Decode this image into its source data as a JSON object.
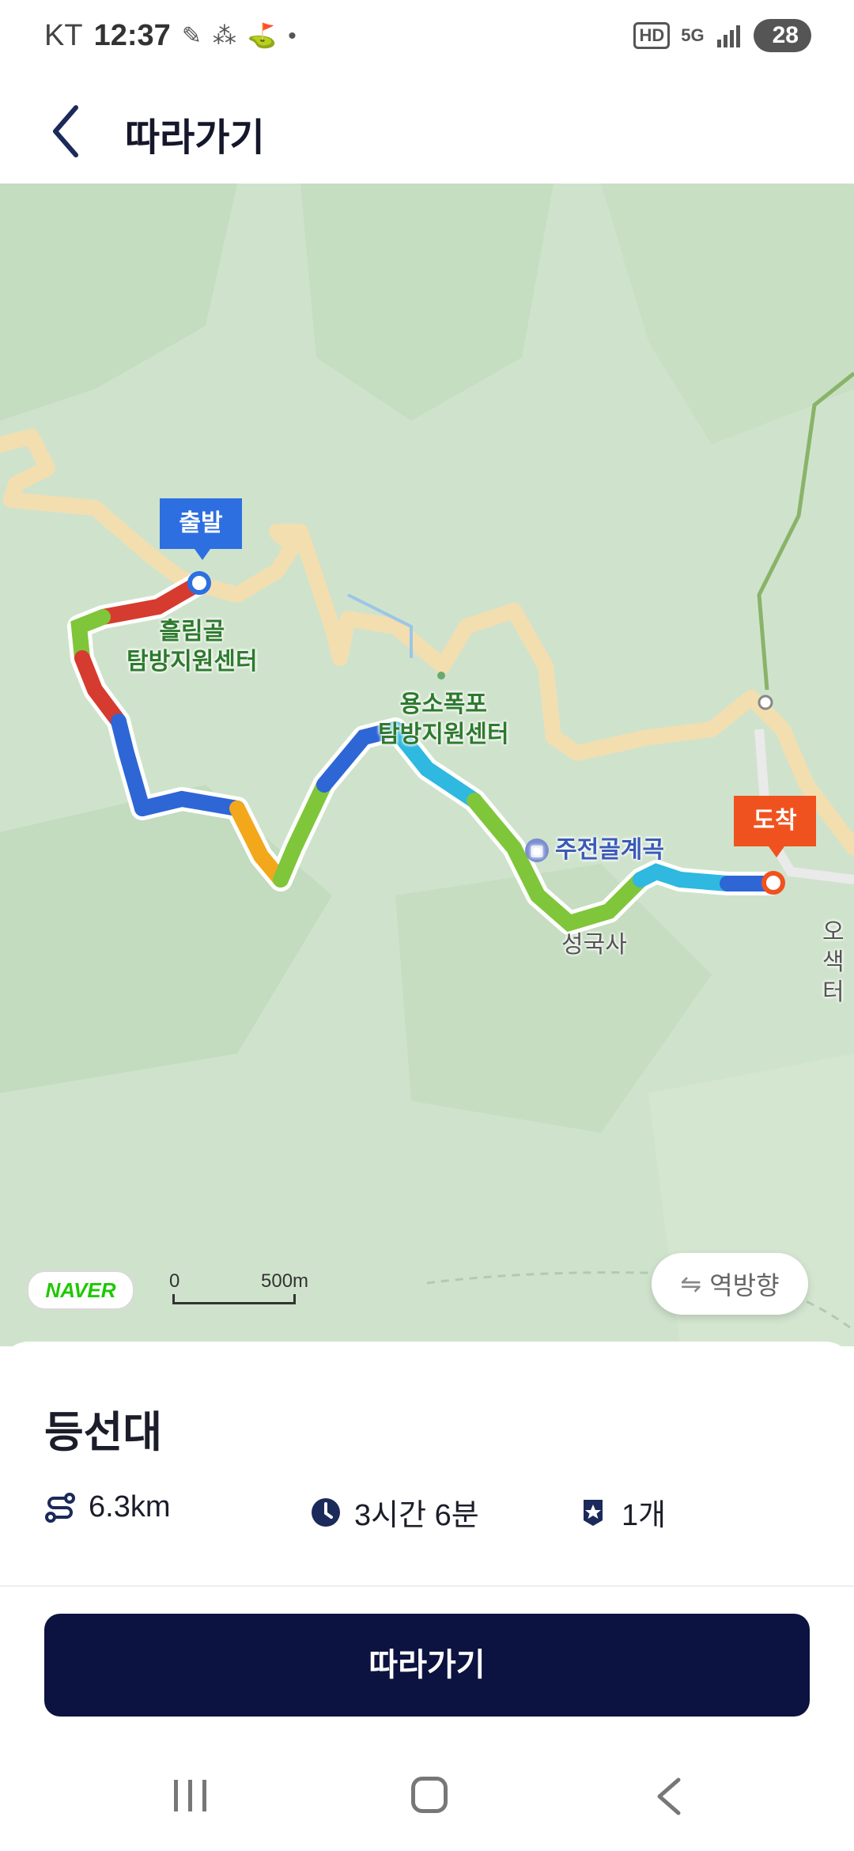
{
  "status_bar": {
    "carrier": "KT",
    "time": "12:37",
    "hd": "HD",
    "network": "5G",
    "battery": "28"
  },
  "header": {
    "title": "따라가기"
  },
  "map": {
    "start_marker": "출발",
    "end_marker": "도착",
    "labels": {
      "heulim": "흘림골\n탐방지원센터",
      "yongso": "용소폭포\n탐방지원센터",
      "jujeon": "주전골계곡",
      "seongguksa": "성국사",
      "oseak": "오색\n터"
    },
    "naver": "NAVER",
    "scale_zero": "0",
    "scale_distance": "500m",
    "reverse_button": "역방향"
  },
  "course": {
    "name": "등선대",
    "distance": "6.3km",
    "duration": "3시간 6분",
    "stamps": "1개"
  },
  "follow_button": "따라가기",
  "colors": {
    "primary": "#0c1340",
    "start": "#2d6fe0",
    "end": "#f0521f"
  }
}
